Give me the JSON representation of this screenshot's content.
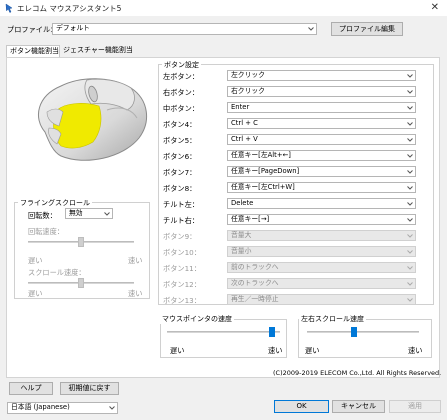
{
  "window": {
    "title": "エレコム マウスアシスタント5",
    "close_glyph": "✕"
  },
  "profile": {
    "label": "プロファイル：",
    "value": "デフォルト",
    "edit_button": "プロファイル編集"
  },
  "tabs": [
    {
      "label": "ボタン機能割当"
    },
    {
      "label": "ジェスチャー機能割当"
    }
  ],
  "button_settings": {
    "title": "ボタン設定",
    "rows": [
      {
        "label": "左ボタン：",
        "value": "左クリック",
        "enabled": true
      },
      {
        "label": "右ボタン：",
        "value": "右クリック",
        "enabled": true
      },
      {
        "label": "中ボタン：",
        "value": "Enter",
        "enabled": true
      },
      {
        "label": "ボタン4：",
        "value": "Ctrl + C",
        "enabled": true
      },
      {
        "label": "ボタン5：",
        "value": "Ctrl + V",
        "enabled": true
      },
      {
        "label": "ボタン6：",
        "value": "任意キー[左Alt+←]",
        "enabled": true
      },
      {
        "label": "ボタン7：",
        "value": "任意キー[PageDown]",
        "enabled": true
      },
      {
        "label": "ボタン8：",
        "value": "任意キー[左Ctrl+W]",
        "enabled": true
      },
      {
        "label": "チルト左：",
        "value": "Delete",
        "enabled": true
      },
      {
        "label": "チルト右：",
        "value": "任意キー[→]",
        "enabled": true
      },
      {
        "label": "ボタン9：",
        "value": "音量大",
        "enabled": false
      },
      {
        "label": "ボタン10：",
        "value": "音量小",
        "enabled": false
      },
      {
        "label": "ボタン11：",
        "value": "前のトラックへ",
        "enabled": false
      },
      {
        "label": "ボタン12：",
        "value": "次のトラックへ",
        "enabled": false
      },
      {
        "label": "ボタン13：",
        "value": "再生／一時停止",
        "enabled": false
      }
    ]
  },
  "flying_scroll": {
    "title": "フライングスクロール",
    "rotation_label": "回転数：",
    "rotation_value": "無効",
    "rotation_speed_label": "回転速度：",
    "scroll_speed_label": "スクロール速度：",
    "slow": "遅い",
    "fast": "速い",
    "rotation_speed_level": 0.5,
    "scroll_speed_level": 0.5
  },
  "pointer_speed": {
    "title": "マウスポインタの速度",
    "slow": "遅い",
    "fast": "速い",
    "level": 0.93
  },
  "horizontal_scroll_speed": {
    "title": "左右スクロール速度",
    "slow": "遅い",
    "fast": "速い",
    "level": 0.42
  },
  "copyright": "(C)2009-2019 ELECOM Co.,Ltd. All Rights Reserved.",
  "footer": {
    "help_button": "ヘルプ",
    "reset_button": "初期値に戻す",
    "language": "日本語 (Japanese)",
    "ok_button": "OK",
    "cancel_button": "キャンセル",
    "apply_button": "適用"
  },
  "colors": {
    "accent": "#0078d7",
    "highlight": "#f0ea00"
  }
}
